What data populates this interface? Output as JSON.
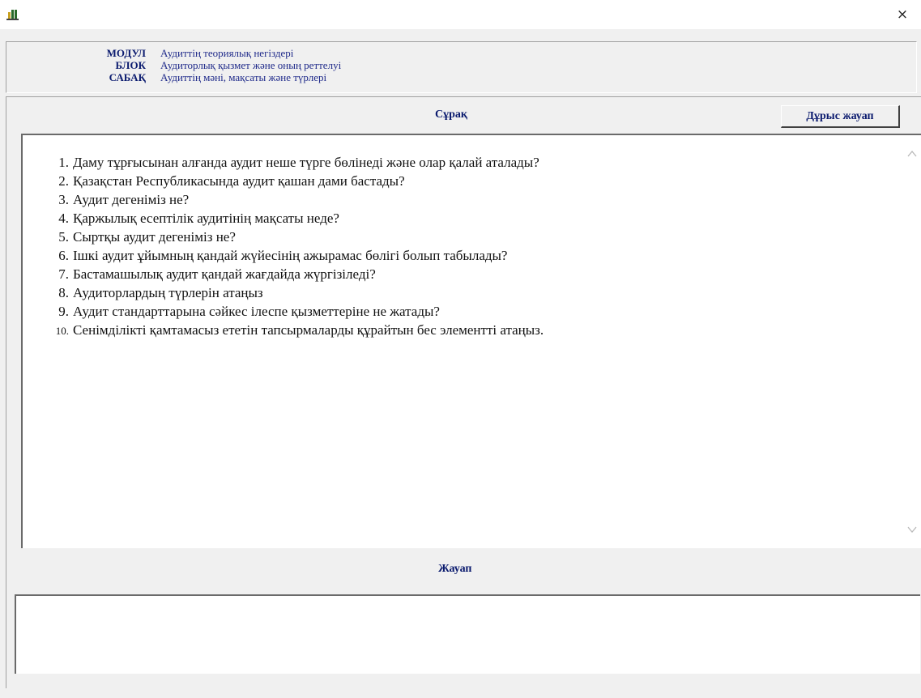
{
  "window": {
    "icon": "app-icon",
    "close_glyph": "×"
  },
  "header": {
    "rows": [
      {
        "key": "МОДУЛ",
        "value": "Аудиттің теориялық негіздері"
      },
      {
        "key": "БЛОК",
        "value": "Аудиторлық қызмет және оның реттелуі"
      },
      {
        "key": "САБАҚ",
        "value": "Аудиттің мәні, мақсаты  және түрлері"
      }
    ]
  },
  "question_section": {
    "label": "Сұрақ",
    "answer_button": "Дұрыс жауап",
    "questions": [
      {
        "num": "1.",
        "text": "Даму тұрғысынан алғанда аудит неше түрге бөлінеді және олар қалай аталады?"
      },
      {
        "num": "2.",
        "text": "Қазақстан Республикасында аудит қашан дами бастады?"
      },
      {
        "num": "3.",
        "text": "Аудит дегеніміз не?"
      },
      {
        "num": "4.",
        "text": "Қаржылық есептілік аудитінің мақсаты неде?"
      },
      {
        "num": "5.",
        "text": "Сыртқы аудит дегеніміз не?"
      },
      {
        "num": "6.",
        "text": "Ішкі аудит ұйымның қандай жүйесінің ажырамас бөлігі болып табылады?"
      },
      {
        "num": "7.",
        "text": "Бастамашылық аудит қандай жағдайда жүргізіледі?"
      },
      {
        "num": "8.",
        "text": "Аудиторлардың түрлерін атаңыз"
      },
      {
        "num": "9.",
        "text": "Аудит  стандарттарына сәйкес ілеспе қызметтеріне не жатады?"
      },
      {
        "num": "10.",
        "text": "Сенімділікті  қамтамасыз  ететін  тапсырмаларды құрайтын бес элементті атаңыз."
      }
    ]
  },
  "answer_section": {
    "label": "Жауап",
    "value": ""
  },
  "colors": {
    "label_blue": "#0a1a6e",
    "value_blue": "#1f2a8a",
    "background": "#f0f0f0"
  }
}
